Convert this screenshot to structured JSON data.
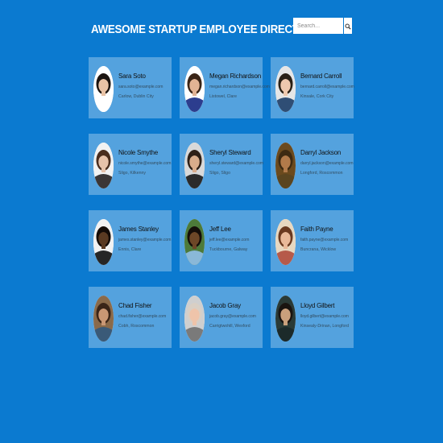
{
  "header": {
    "title": "AWESOME STARTUP EMPLOYEE DIRECTORY"
  },
  "search": {
    "placeholder": "Search...",
    "button_icon": "search-icon"
  },
  "employees": [
    {
      "name": "Sara Soto",
      "email": "sara.soto@example.com",
      "location": "Carlow, Dublin City",
      "skin": "#e9c3a6",
      "hair": "#1b1410",
      "shirt": "#ffffff",
      "bg": "#ffffff"
    },
    {
      "name": "Megan Richardson",
      "email": "megan.richardson@example.com",
      "location": "Listowel, Clare",
      "skin": "#e2b394",
      "hair": "#3a2416",
      "shirt": "#2c3d8e",
      "bg": "#ffffff"
    },
    {
      "name": "Bernard Carroll",
      "email": "bernard.carroll@example.com",
      "location": "Kinsale, Cork City",
      "skin": "#eec8ae",
      "hair": "#2a2016",
      "shirt": "#2f4e75",
      "bg": "#e6e6e6"
    },
    {
      "name": "Nicole Smythe",
      "email": "nicole.smythe@example.com",
      "location": "Sligo, Kilkenny",
      "skin": "#e7c2aa",
      "hair": "#4a2d1e",
      "shirt": "#3b3636",
      "bg": "#f2f2f2"
    },
    {
      "name": "Sheryl Steward",
      "email": "sheryl.steward@example.com",
      "location": "Sligo, Sligo",
      "skin": "#d9ad8c",
      "hair": "#2e2017",
      "shirt": "#2b2b2b",
      "bg": "#d9d9d9"
    },
    {
      "name": "Darryl Jackson",
      "email": "darryl.jackson@example.com",
      "location": "Longford, Roscommon",
      "skin": "#b17a4a",
      "hair": "#3d2a12",
      "shirt": "#5a4520",
      "bg": "#6b4a1e"
    },
    {
      "name": "James Stanley",
      "email": "james.stanley@example.com",
      "location": "Ennis, Clare",
      "skin": "#5a3a22",
      "hair": "#140c08",
      "shirt": "#262626",
      "bg": "#f2f2f2"
    },
    {
      "name": "Jeff Lee",
      "email": "jeff.lee@example.com",
      "location": "Tuckbourne, Galway",
      "skin": "#6d4727",
      "hair": "#150e09",
      "shirt": "#8ab8d8",
      "bg": "#4d7a3a"
    },
    {
      "name": "Faith Payne",
      "email": "faith.payne@example.com",
      "location": "Buncrana, Wicklow",
      "skin": "#e9b999",
      "hair": "#6b3a20",
      "shirt": "#b65a4a",
      "bg": "#e8d8c0"
    },
    {
      "name": "Chad Fisher",
      "email": "chad.fisher@example.com",
      "location": "Cobh, Roscommon",
      "skin": "#c99774",
      "hair": "#3a2518",
      "shirt": "#3a5a78",
      "bg": "#8a6a4a"
    },
    {
      "name": "Jacob Gray",
      "email": "jacob.gray@example.com",
      "location": "Carrigtwohill, Wexford",
      "skin": "#efc4aa",
      "hair": "#d9cfc4",
      "shirt": "#7a7a7a",
      "bg": "#cfcfcf"
    },
    {
      "name": "Lloyd Gilbert",
      "email": "lloyd.gilbert@example.com",
      "location": "Kinsealy-Drinan, Longford",
      "skin": "#c9a07c",
      "hair": "#1a1410",
      "shirt": "#1c2a2a",
      "bg": "#2a3a36"
    }
  ]
}
